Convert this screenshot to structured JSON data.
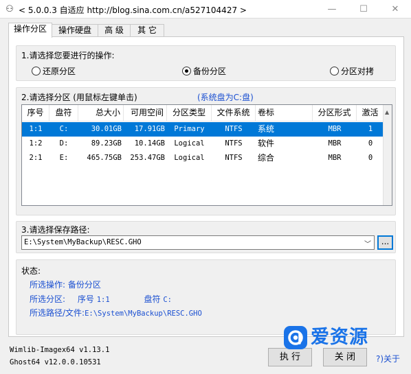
{
  "window": {
    "title": "< 5.0.0.3 自适应 http://blog.sina.com.cn/a527104427 >",
    "minimize_glyph": "—",
    "maximize_glyph": "☐",
    "close_glyph": "✕"
  },
  "tabs": [
    {
      "label": "操作分区",
      "active": true
    },
    {
      "label": "操作硬盘",
      "active": false
    },
    {
      "label": "高 级",
      "active": false
    },
    {
      "label": "其 它",
      "active": false
    }
  ],
  "step1": {
    "label": "1.请选择您要进行的操作:",
    "options": [
      {
        "label": "还原分区",
        "checked": false
      },
      {
        "label": "备份分区",
        "checked": true
      },
      {
        "label": "分区对拷",
        "checked": false
      }
    ]
  },
  "step2": {
    "label": "2.请选择分区 (用鼠标左键单击)",
    "system_disk": "(系统盘为C:盘)",
    "columns": [
      "序号",
      "盘符",
      "总大小",
      "可用空间",
      "分区类型",
      "文件系统",
      "卷标",
      "分区形式",
      "激活"
    ],
    "rows": [
      {
        "index": "1:1",
        "drive": "C:",
        "total": "30.01GB",
        "free": "17.91GB",
        "type": "Primary",
        "fs": "NTFS",
        "label": "系统",
        "form": "MBR",
        "active": "1",
        "selected": true
      },
      {
        "index": "1:2",
        "drive": "D:",
        "total": "89.23GB",
        "free": "10.14GB",
        "type": "Logical",
        "fs": "NTFS",
        "label": "软件",
        "form": "MBR",
        "active": "0",
        "selected": false
      },
      {
        "index": "2:1",
        "drive": "E:",
        "total": "465.75GB",
        "free": "253.47GB",
        "type": "Logical",
        "fs": "NTFS",
        "label": "综合",
        "form": "MBR",
        "active": "0",
        "selected": false
      }
    ]
  },
  "step3": {
    "label": "3.请选择保存路径:",
    "path_value": "E:\\System\\MyBackup\\RESC.GHO",
    "browse_label": "..."
  },
  "status": {
    "label": "状态:",
    "operation_label": "所选操作:",
    "operation_value": "备份分区",
    "partition_label": "所选分区:",
    "partition_index_label": "序号",
    "partition_index_value": "1:1",
    "partition_drive_label": "盘符",
    "partition_drive_value": "C:",
    "path_label": "所选路径/文件:",
    "path_value": "E:\\System\\MyBackup\\RESC.GHO"
  },
  "footer": {
    "wimlib_version": "Wimlib-Imagex64 v1.13.1",
    "ghost_version": "Ghost64 v12.0.0.10531",
    "execute_label": "执 行",
    "close_label": "关 闭",
    "about_label": "?)关于"
  },
  "watermark": {
    "text": "爱资源"
  },
  "colors": {
    "accent": "#0078d7",
    "link_blue": "#1a4fd1",
    "watermark_blue": "#1a73e8"
  }
}
